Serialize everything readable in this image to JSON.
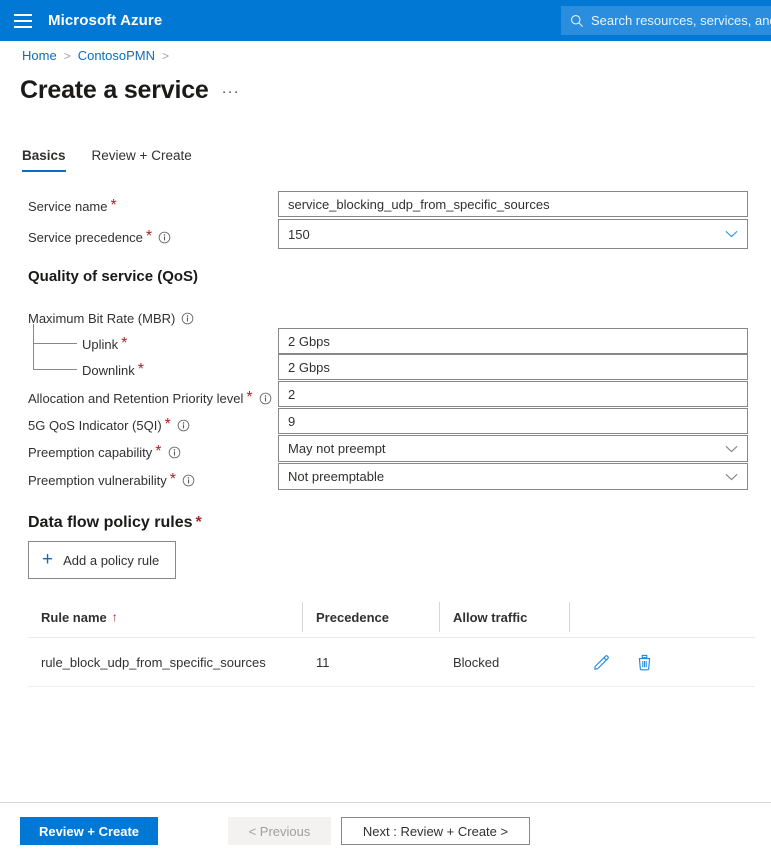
{
  "topbar": {
    "menu_icon": "hamburger-icon",
    "brand": "Microsoft Azure",
    "search_icon": "search-icon",
    "search_placeholder": "Search resources, services, and docs (G+/)"
  },
  "breadcrumb": {
    "items": [
      "Home",
      "ContosoPMN"
    ],
    "separator": ">"
  },
  "page": {
    "title": "Create a service",
    "ellipsis": "···"
  },
  "tabs": [
    {
      "label": "Basics",
      "active": true
    },
    {
      "label": "Review + Create",
      "active": false
    }
  ],
  "basics": {
    "service_name": {
      "label": "Service name",
      "required": "*",
      "value": "service_blocking_udp_from_specific_sources"
    },
    "service_precedence": {
      "label": "Service precedence",
      "required": "*",
      "info": "info-icon",
      "value": "150"
    }
  },
  "qos": {
    "heading": "Quality of service (QoS)",
    "mbr": {
      "label": "Maximum Bit Rate (MBR)",
      "info": "info-icon"
    },
    "uplink": {
      "label": "Uplink",
      "required": "*",
      "value": "2 Gbps"
    },
    "downlink": {
      "label": "Downlink",
      "required": "*",
      "value": "2 Gbps"
    },
    "arp": {
      "label": "Allocation and Retention Priority level",
      "required": "*",
      "info": "info-icon",
      "value": "2"
    },
    "fiveqi": {
      "label": "5G QoS Indicator (5QI)",
      "required": "*",
      "info": "info-icon",
      "value": "9"
    },
    "preemption_capability": {
      "label": "Preemption capability",
      "required": "*",
      "info": "info-icon",
      "value": "May not preempt"
    },
    "preemption_vulnerability": {
      "label": "Preemption vulnerability",
      "required": "*",
      "info": "info-icon",
      "value": "Not preemptable"
    }
  },
  "policy_rules": {
    "heading": "Data flow policy rules",
    "required": "*",
    "add_button": {
      "label": "Add a policy rule",
      "icon": "plus-icon"
    },
    "columns": [
      "Rule name",
      "Precedence",
      "Allow traffic",
      ""
    ],
    "sort_indicator": "↑",
    "rows": [
      {
        "rule_name": "rule_block_udp_from_specific_sources",
        "precedence": "11",
        "allow_traffic": "Blocked",
        "edit_icon": "pencil-icon",
        "delete_icon": "trash-icon"
      }
    ]
  },
  "footer": {
    "review_create": "Review + Create",
    "previous": "< Previous",
    "next": "Next : Review + Create >"
  },
  "colors": {
    "azure_blue": "#0078d4",
    "link_blue": "#0f6cbd",
    "required_red": "#a4262c",
    "border_gray": "#8a8886"
  }
}
